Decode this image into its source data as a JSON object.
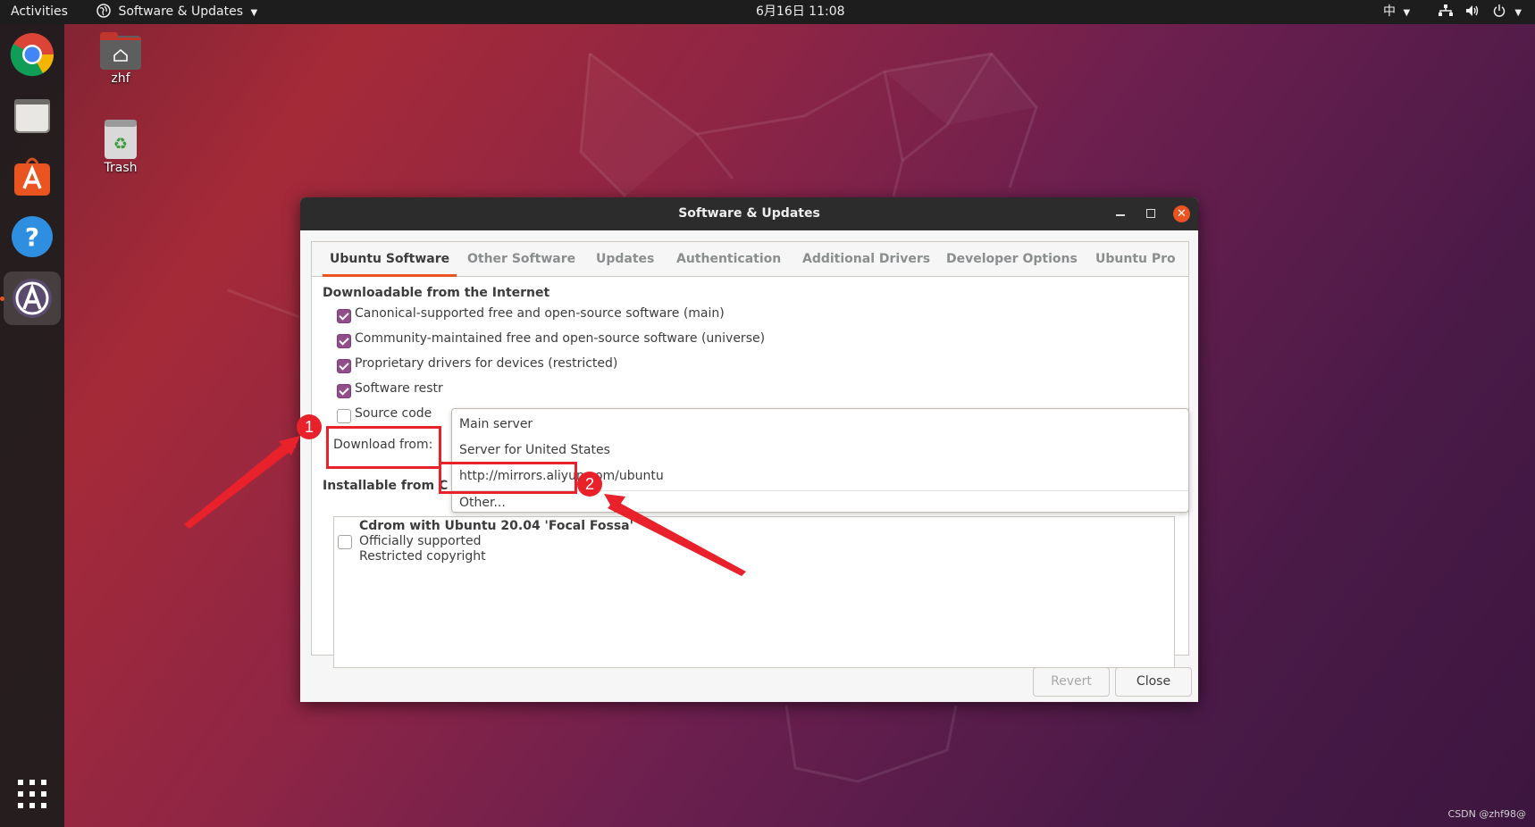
{
  "topbar": {
    "activities": "Activities",
    "app_menu": "Software & Updates",
    "clock": "6月16日  11:08",
    "input_method": "中"
  },
  "desktop": {
    "home_label": "zhf",
    "trash_label": "Trash"
  },
  "dock": {
    "items": [
      "chrome-icon",
      "files-icon",
      "ubuntu-software-icon",
      "help-icon",
      "software-updater-icon"
    ]
  },
  "window": {
    "title": "Software & Updates",
    "tabs": [
      "Ubuntu Software",
      "Other Software",
      "Updates",
      "Authentication",
      "Additional Drivers",
      "Developer Options",
      "Ubuntu Pro"
    ],
    "active_tab": "Ubuntu Software",
    "section_internet": "Downloadable from the Internet",
    "options": [
      {
        "label": "Canonical-supported free and open-source software (main)",
        "checked": true
      },
      {
        "label": "Community-maintained free and open-source software (universe)",
        "checked": true
      },
      {
        "label": "Proprietary drivers for devices (restricted)",
        "checked": true
      },
      {
        "label": "Software restr",
        "checked": true
      },
      {
        "label": "Source code",
        "checked": false
      }
    ],
    "download_from_label": "Download from:",
    "server_options": [
      "Main server",
      "Server for United States",
      "http://mirrors.aliyun.com/ubuntu",
      "Other..."
    ],
    "section_cdrom": "Installable from C",
    "cdrom": {
      "title": "Cdrom with Ubuntu 20.04 'Focal Fossa'",
      "line1": "Officially supported",
      "line2": "Restricted copyright",
      "checked": false
    },
    "revert_label": "Revert",
    "close_label": "Close"
  },
  "annotations": {
    "badge1": "1",
    "badge2": "2"
  },
  "watermark": "CSDN @zhf98@",
  "colors": {
    "accent": "#e95420",
    "checkbox": "#924d8b",
    "annotation": "#e8212a"
  }
}
